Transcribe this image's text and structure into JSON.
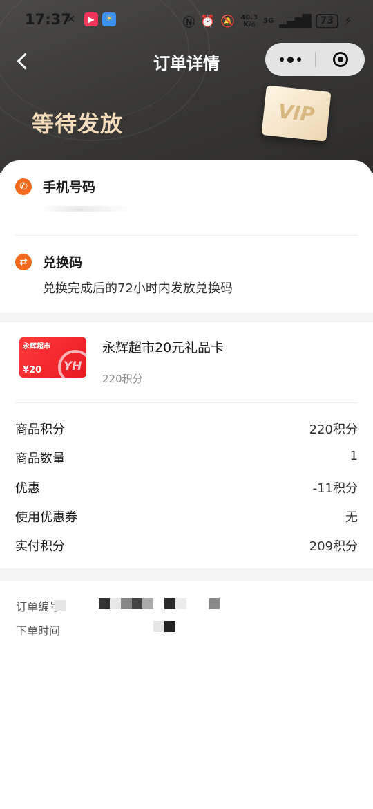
{
  "status_bar": {
    "time": "17:37",
    "net_speed_value": "40.3",
    "net_speed_unit": "K/s",
    "network": "5G",
    "battery": "73"
  },
  "nav": {
    "title": "订单详情"
  },
  "order": {
    "status": "等待发放",
    "vip_badge": "VIP"
  },
  "phone_section": {
    "label": "手机号码"
  },
  "code_section": {
    "label": "兑换码",
    "description": "兑换完成后的72小时内发放兑换码"
  },
  "product": {
    "card_brand": "永辉超市",
    "card_price": "¥20",
    "card_logo": "YH",
    "name": "永辉超市20元礼品卡",
    "points": "220积分"
  },
  "summary": [
    {
      "label": "商品积分",
      "value": "220积分"
    },
    {
      "label": "商品数量",
      "value": "1"
    },
    {
      "label": "优惠",
      "value": "-11积分"
    },
    {
      "label": "使用优惠券",
      "value": "无"
    },
    {
      "label": "实付积分",
      "value": "209积分"
    }
  ],
  "meta": {
    "order_no_label": "订单编号",
    "order_time_label": "下单时间"
  },
  "colors": {
    "accent_orange": "#f26b1d",
    "status_gold": "#f4dcbb",
    "header_dark": "#3a3937",
    "gift_red": "#e81a22"
  }
}
